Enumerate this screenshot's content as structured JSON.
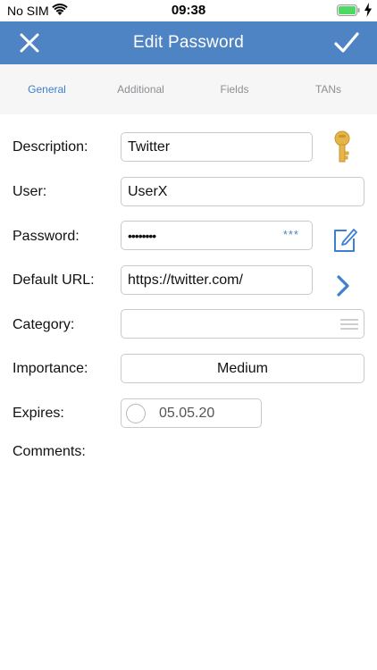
{
  "status_bar": {
    "carrier": "No SIM",
    "time": "09:38",
    "wifi_icon": "wifi-icon",
    "battery_icon": "battery-icon",
    "battery_level": 1.0,
    "battery_color": "#4cd964"
  },
  "nav": {
    "title": "Edit Password",
    "close_icon": "close-icon",
    "done_icon": "checkmark-icon",
    "background_color": "#4f84c4"
  },
  "tabs": [
    {
      "label": "General",
      "active": true
    },
    {
      "label": "Additional",
      "active": false
    },
    {
      "label": "Fields",
      "active": false
    },
    {
      "label": "TANs",
      "active": false
    }
  ],
  "form": {
    "description": {
      "label": "Description:",
      "value": "Twitter",
      "icon": "key-icon"
    },
    "user": {
      "label": "User:",
      "value": "UserX"
    },
    "password": {
      "label": "Password:",
      "value": "••••••••",
      "reveal_label": "***",
      "icon": "edit-icon"
    },
    "default_url": {
      "label": "Default URL:",
      "value": "https://twitter.com/",
      "icon": "chevron-right-icon"
    },
    "category": {
      "label": "Category:",
      "value": "",
      "icon": "list-icon"
    },
    "importance": {
      "label": "Importance:",
      "value": "Medium"
    },
    "expires": {
      "label": "Expires:",
      "value": "05.05.20",
      "checked": false
    },
    "comments": {
      "label": "Comments:",
      "value": ""
    }
  },
  "accent_color": "#3d7fd1",
  "key_color": "#e6b54a"
}
